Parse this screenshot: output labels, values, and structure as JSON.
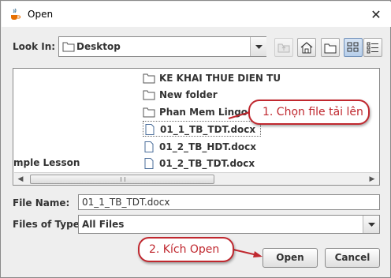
{
  "window": {
    "title": "Open",
    "close_glyph": "✕"
  },
  "look_in": {
    "label": "Look In:",
    "value": "Desktop"
  },
  "toolbar": {
    "icons": [
      "up-folder-icon",
      "home-icon",
      "new-folder-icon",
      "list-view-icon",
      "details-view-icon"
    ]
  },
  "file_list": {
    "left_item": "mple Lesson",
    "items": [
      {
        "name": "KE KHAI THUE DIEN TU",
        "type": "folder"
      },
      {
        "name": "New folder",
        "type": "folder"
      },
      {
        "name": "Phan Mem Lingoes",
        "type": "folder"
      },
      {
        "name": "01_1_TB_TDT.docx",
        "type": "file"
      },
      {
        "name": "01_2_TB_HDT.docx",
        "type": "file"
      },
      {
        "name": "01_2_TB_TDT.docx",
        "type": "file"
      }
    ]
  },
  "file_name": {
    "label": "File Name:",
    "value": "01_1_TB_TDT.docx"
  },
  "files_of_type": {
    "label": "Files of Type:",
    "value": "All Files"
  },
  "buttons": {
    "open": "Open",
    "cancel": "Cancel"
  },
  "annotations": {
    "step1": "1. Chọn file  tải lên",
    "step2": "2. Kích Open"
  },
  "colors": {
    "callout": "#c0282f",
    "selection_border": "#6f6f6f"
  }
}
